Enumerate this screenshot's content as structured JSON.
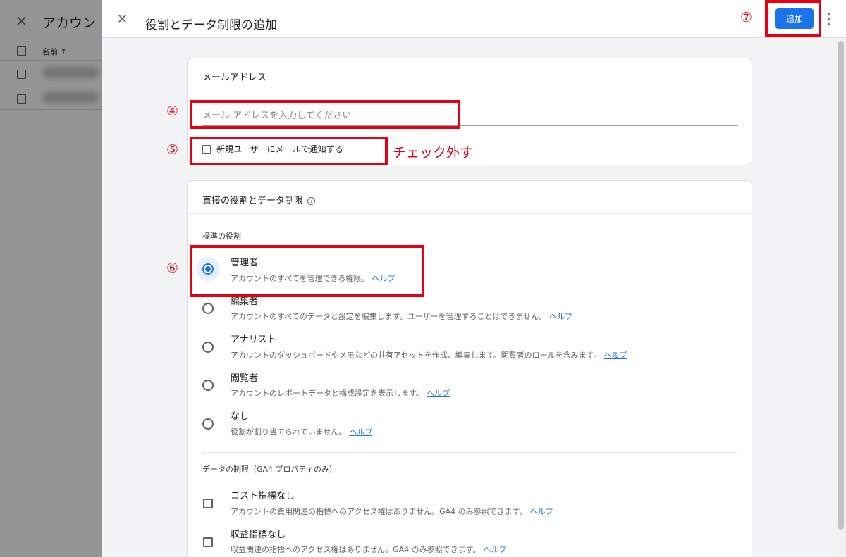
{
  "background": {
    "title": "アカウン",
    "column_name": "名前 ↑"
  },
  "dialog": {
    "title": "役割とデータ制限の追加",
    "add_button": "追加"
  },
  "email_card": {
    "title": "メールアドレス",
    "email_placeholder": "メール アドレスを入力してください",
    "notify_label": "新規ユーザーにメールで通知する"
  },
  "roles_card": {
    "title": "直接の役割とデータ制限",
    "standard_roles_label": "標準の役割",
    "roles": [
      {
        "title": "管理者",
        "desc": "アカウントのすべてを管理できる権限。",
        "help": "ヘルプ",
        "selected": true
      },
      {
        "title": "編集者",
        "desc": "アカウントのすべてのデータと設定を編集します。ユーザーを管理することはできません。",
        "help": "ヘルプ",
        "selected": false
      },
      {
        "title": "アナリスト",
        "desc": "アカウントのダッシュボードやメモなどの共有アセットを作成、編集します。閲覧者のロールを含みます。",
        "help": "ヘルプ",
        "selected": false
      },
      {
        "title": "閲覧者",
        "desc": "アカウントのレポートデータと構成設定を表示します。",
        "help": "ヘルプ",
        "selected": false
      },
      {
        "title": "なし",
        "desc": "役割が割り当てられていません。",
        "help": "ヘルプ",
        "selected": false
      }
    ],
    "data_restrictions_label": "データの制限（GA4 プロパティのみ）",
    "restrictions": [
      {
        "title": "コスト指標なし",
        "desc": "アカウントの費用関連の指標へのアクセス権はありません。GA4 のみ参照できます。",
        "help": "ヘルプ"
      },
      {
        "title": "収益指標なし",
        "desc": "収益関連の指標へのアクセス権はありません。GA4 のみ参照できます。",
        "help": "ヘルプ"
      }
    ]
  },
  "annotations": {
    "step4": "④",
    "step5": "⑤",
    "step6": "⑥",
    "step7": "⑦",
    "uncheck_note": "チェック外す"
  },
  "colors": {
    "accent": "#1a73e8",
    "annotation": "#e60012"
  }
}
